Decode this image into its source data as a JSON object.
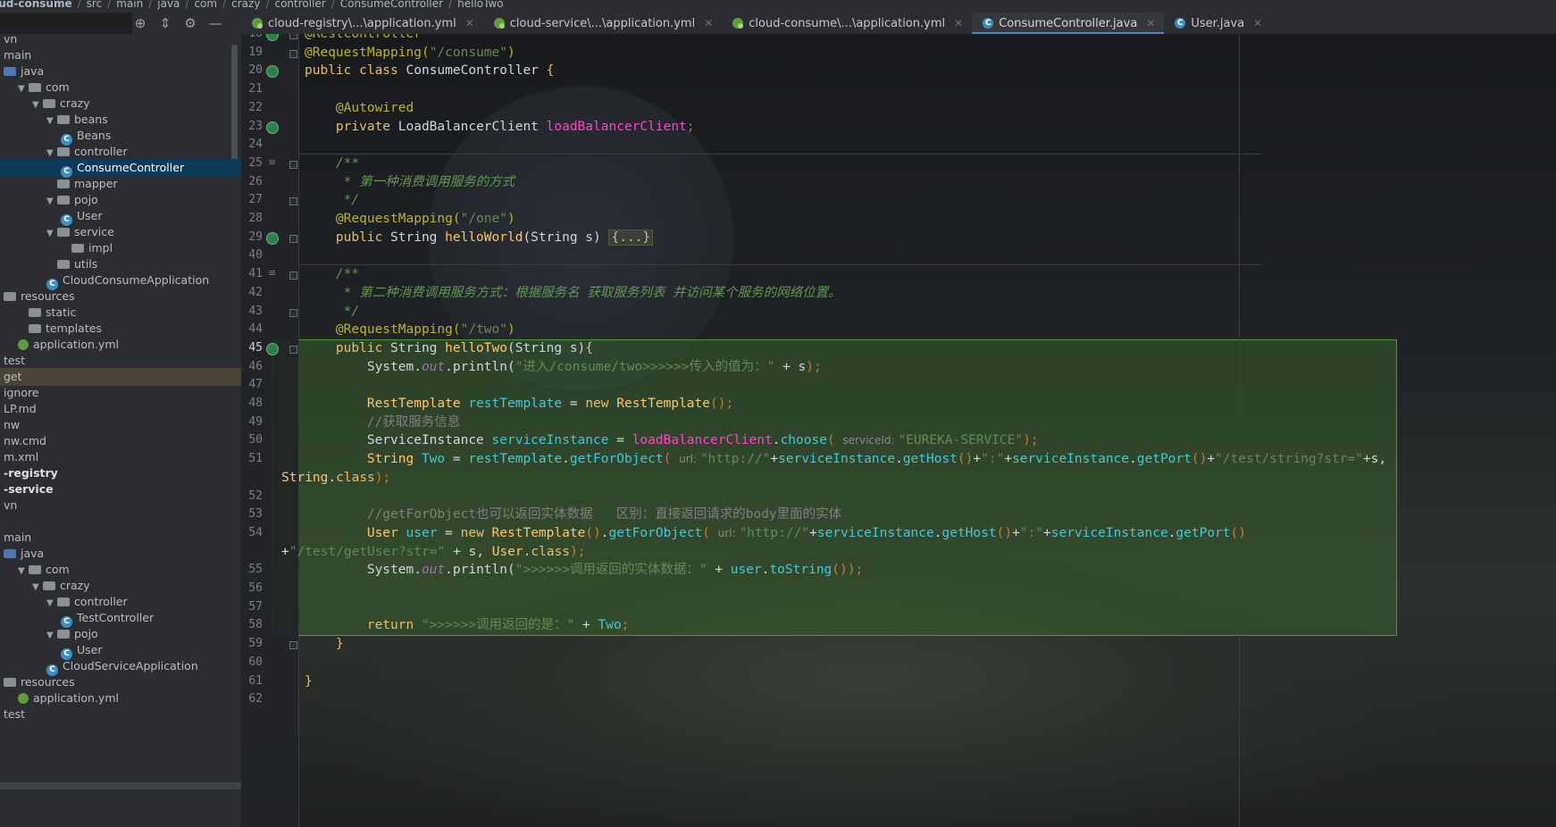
{
  "breadcrumb": [
    "oud-consume",
    "src",
    "main",
    "java",
    "com",
    "crazy",
    "controller",
    "ConsumeController",
    "helloTwo"
  ],
  "toolbar": {
    "icons": [
      "crosshair-icon",
      "collapse-icon",
      "gear-icon",
      "minimize-icon"
    ],
    "glyphs": [
      "⊕",
      "⇕",
      "⚙",
      "—"
    ]
  },
  "tabs": [
    {
      "label": "cloud-registry\\...\\application.yml",
      "icon": "yml",
      "active": false
    },
    {
      "label": "cloud-service\\...\\application.yml",
      "icon": "yml",
      "active": false
    },
    {
      "label": "cloud-consume\\...\\application.yml",
      "icon": "yml",
      "active": false
    },
    {
      "label": "ConsumeController.java",
      "icon": "class",
      "active": true
    },
    {
      "label": "User.java",
      "icon": "class",
      "active": false
    }
  ],
  "tab_close": "✕",
  "tree": [
    {
      "label": "vn",
      "indent": 0,
      "arrow": "",
      "icon": "none"
    },
    {
      "label": "main",
      "indent": 0,
      "arrow": "",
      "icon": "none"
    },
    {
      "label": "java",
      "indent": 0,
      "arrow": "",
      "icon": "folder-blue"
    },
    {
      "label": "com",
      "indent": 1,
      "arrow": "▼",
      "icon": "folder"
    },
    {
      "label": "crazy",
      "indent": 2,
      "arrow": "▼",
      "icon": "folder"
    },
    {
      "label": "beans",
      "indent": 3,
      "arrow": "▼",
      "icon": "folder"
    },
    {
      "label": "Beans",
      "indent": 4,
      "arrow": "",
      "icon": "class"
    },
    {
      "label": "controller",
      "indent": 3,
      "arrow": "▼",
      "icon": "folder"
    },
    {
      "label": "ConsumeController",
      "indent": 4,
      "arrow": "",
      "icon": "class",
      "selected": true
    },
    {
      "label": "mapper",
      "indent": 3,
      "arrow": "",
      "icon": "folder"
    },
    {
      "label": "pojo",
      "indent": 3,
      "arrow": "▼",
      "icon": "folder"
    },
    {
      "label": "User",
      "indent": 4,
      "arrow": "",
      "icon": "class"
    },
    {
      "label": "service",
      "indent": 3,
      "arrow": "▼",
      "icon": "folder"
    },
    {
      "label": "impl",
      "indent": 4,
      "arrow": "",
      "icon": "folder"
    },
    {
      "label": "utils",
      "indent": 3,
      "arrow": "",
      "icon": "folder"
    },
    {
      "label": "CloudConsumeApplication",
      "indent": 3,
      "arrow": "",
      "icon": "class"
    },
    {
      "label": "resources",
      "indent": 0,
      "arrow": "",
      "icon": "folder"
    },
    {
      "label": "static",
      "indent": 1,
      "arrow": "",
      "icon": "folder"
    },
    {
      "label": "templates",
      "indent": 1,
      "arrow": "",
      "icon": "folder"
    },
    {
      "label": "application.yml",
      "indent": 1,
      "arrow": "",
      "icon": "yml"
    },
    {
      "label": "test",
      "indent": 0,
      "arrow": "",
      "icon": "none"
    },
    {
      "label": "get",
      "indent": 0,
      "arrow": "",
      "icon": "none",
      "highlight": true
    },
    {
      "label": "ignore",
      "indent": 0,
      "arrow": "",
      "icon": "none"
    },
    {
      "label": "LP.md",
      "indent": 0,
      "arrow": "",
      "icon": "none"
    },
    {
      "label": "nw",
      "indent": 0,
      "arrow": "",
      "icon": "none"
    },
    {
      "label": "nw.cmd",
      "indent": 0,
      "arrow": "",
      "icon": "none"
    },
    {
      "label": "m.xml",
      "indent": 0,
      "arrow": "",
      "icon": "none"
    },
    {
      "label": "-registry",
      "indent": 0,
      "arrow": "",
      "icon": "none",
      "bold": true
    },
    {
      "label": "-service",
      "indent": 0,
      "arrow": "",
      "icon": "none",
      "bold": true
    },
    {
      "label": "vn",
      "indent": 0,
      "arrow": "",
      "icon": "none"
    },
    {
      "label": "",
      "indent": 0,
      "arrow": "",
      "icon": "none"
    },
    {
      "label": "main",
      "indent": 0,
      "arrow": "",
      "icon": "none"
    },
    {
      "label": "java",
      "indent": 0,
      "arrow": "",
      "icon": "folder-blue"
    },
    {
      "label": "com",
      "indent": 1,
      "arrow": "▼",
      "icon": "folder"
    },
    {
      "label": "crazy",
      "indent": 2,
      "arrow": "▼",
      "icon": "folder"
    },
    {
      "label": "controller",
      "indent": 3,
      "arrow": "▼",
      "icon": "folder"
    },
    {
      "label": "TestController",
      "indent": 4,
      "arrow": "",
      "icon": "class"
    },
    {
      "label": "pojo",
      "indent": 3,
      "arrow": "▼",
      "icon": "folder"
    },
    {
      "label": "User",
      "indent": 4,
      "arrow": "",
      "icon": "class"
    },
    {
      "label": "CloudServiceApplication",
      "indent": 3,
      "arrow": "",
      "icon": "class"
    },
    {
      "label": "resources",
      "indent": 0,
      "arrow": "",
      "icon": "folder"
    },
    {
      "label": "application.yml",
      "indent": 1,
      "arrow": "",
      "icon": "yml"
    },
    {
      "label": "test",
      "indent": 0,
      "arrow": "",
      "icon": "none"
    }
  ],
  "editor": {
    "current_line": "45",
    "lines": [
      {
        "n": "18",
        "g": "bean",
        "f": "fold",
        "segs": [
          [
            "ann",
            "@RestController"
          ]
        ]
      },
      {
        "n": "19",
        "g": "",
        "f": "fold",
        "segs": [
          [
            "ann",
            "@RequestMapping("
          ],
          [
            "str",
            "\"/consume\""
          ],
          [
            "ann",
            ")"
          ]
        ]
      },
      {
        "n": "20",
        "g": "bean",
        "f": "",
        "segs": [
          [
            "kwy",
            "public class "
          ],
          [
            "dim",
            "ConsumeController "
          ],
          [
            "kwy",
            "{"
          ]
        ]
      },
      {
        "n": "21",
        "g": "",
        "f": "",
        "segs": []
      },
      {
        "n": "22",
        "g": "",
        "f": "",
        "segs": [
          [
            "",
            "    "
          ],
          [
            "ann",
            "@Autowired"
          ]
        ]
      },
      {
        "n": "23",
        "g": "bean",
        "f": "",
        "segs": [
          [
            "",
            "    "
          ],
          [
            "kwy",
            "private "
          ],
          [
            "dim",
            "LoadBalancerClient "
          ],
          [
            "pink",
            "loadBalancerClient"
          ],
          [
            "kw",
            ";"
          ]
        ]
      },
      {
        "n": "24",
        "g": "",
        "f": "",
        "segs": []
      },
      {
        "n": "25",
        "g": "doc",
        "f": "fold",
        "segs": [
          [
            "",
            "    "
          ],
          [
            "doc",
            "/**"
          ]
        ]
      },
      {
        "n": "26",
        "g": "",
        "f": "",
        "segs": [
          [
            "",
            "    "
          ],
          [
            "doc",
            " * 第一种消费调用服务的方式"
          ]
        ]
      },
      {
        "n": "27",
        "g": "",
        "f": "fold",
        "segs": [
          [
            "",
            "    "
          ],
          [
            "doc",
            " */"
          ]
        ]
      },
      {
        "n": "28",
        "g": "",
        "f": "",
        "segs": [
          [
            "",
            "    "
          ],
          [
            "ann",
            "@RequestMapping("
          ],
          [
            "str",
            "\"/one\""
          ],
          [
            "ann",
            ")"
          ]
        ]
      },
      {
        "n": "29",
        "g": "bean",
        "f": "plus",
        "segs": [
          [
            "",
            "    "
          ],
          [
            "kwy",
            "public "
          ],
          [
            "dim",
            "String "
          ],
          [
            "yel",
            "helloWorld"
          ],
          [
            "dim",
            "(String s) "
          ],
          [
            "box",
            "{...}"
          ]
        ]
      },
      {
        "n": "40",
        "g": "",
        "f": "",
        "segs": []
      },
      {
        "n": "41",
        "g": "doc",
        "f": "fold",
        "segs": [
          [
            "",
            "    "
          ],
          [
            "doc",
            "/**"
          ]
        ]
      },
      {
        "n": "42",
        "g": "",
        "f": "",
        "segs": [
          [
            "",
            "    "
          ],
          [
            "doc",
            " * 第二种消费调用服务方式：根据服务名 获取服务列表 并访问某个服务的网络位置。"
          ]
        ]
      },
      {
        "n": "43",
        "g": "",
        "f": "fold",
        "segs": [
          [
            "",
            "    "
          ],
          [
            "doc",
            " */"
          ]
        ]
      },
      {
        "n": "44",
        "g": "",
        "f": "",
        "segs": [
          [
            "",
            "    "
          ],
          [
            "ann",
            "@RequestMapping("
          ],
          [
            "str",
            "\"/two\""
          ],
          [
            "ann",
            ")"
          ]
        ]
      },
      {
        "n": "45",
        "g": "bean",
        "f": "fold",
        "segs": [
          [
            "",
            "    "
          ],
          [
            "kwy",
            "public "
          ],
          [
            "dim",
            "String "
          ],
          [
            "yel",
            "helloTwo"
          ],
          [
            "dim",
            "(String s)"
          ],
          [
            "kwy",
            "{"
          ]
        ]
      },
      {
        "n": "46",
        "g": "",
        "f": "",
        "segs": [
          [
            "",
            "        "
          ],
          [
            "dim",
            "System."
          ],
          [
            "it",
            "out"
          ],
          [
            "dim",
            ".println("
          ],
          [
            "str",
            "\"进入/consume/two>>>>>>传入的值为：\" "
          ],
          [
            "dim",
            "+ s"
          ],
          [
            "kw",
            ");"
          ]
        ]
      },
      {
        "n": "47",
        "g": "",
        "f": "",
        "segs": []
      },
      {
        "n": "48",
        "g": "",
        "f": "",
        "segs": [
          [
            "",
            "        "
          ],
          [
            "yel",
            "RestTemplate "
          ],
          [
            "cyan",
            "restTemplate "
          ],
          [
            "dim",
            "= "
          ],
          [
            "kwy",
            "new "
          ],
          [
            "yel",
            "RestTemplate"
          ],
          [
            "kw",
            "();"
          ]
        ]
      },
      {
        "n": "49",
        "g": "",
        "f": "",
        "segs": [
          [
            "",
            "        "
          ],
          [
            "cmt",
            "//获取服务信息"
          ]
        ]
      },
      {
        "n": "50",
        "g": "",
        "f": "",
        "segs": [
          [
            "",
            "        "
          ],
          [
            "dim",
            "ServiceInstance "
          ],
          [
            "cyan",
            "serviceInstance "
          ],
          [
            "dim",
            "= "
          ],
          [
            "pink",
            "loadBalancerClient"
          ],
          [
            "dim",
            "."
          ],
          [
            "cyan",
            "choose"
          ],
          [
            "kw",
            "( "
          ],
          [
            "hint",
            "serviceId: "
          ],
          [
            "str",
            "\"EUREKA-SERVICE\""
          ],
          [
            "kw",
            ");"
          ]
        ]
      },
      {
        "n": "51",
        "g": "",
        "f": "",
        "segs": [
          [
            "",
            "        "
          ],
          [
            "yel",
            "String "
          ],
          [
            "cyan",
            "Two "
          ],
          [
            "dim",
            "= "
          ],
          [
            "cyan",
            "restTemplate"
          ],
          [
            "dim",
            "."
          ],
          [
            "cyan",
            "getForObject"
          ],
          [
            "kw",
            "( "
          ],
          [
            "hint",
            "url: "
          ],
          [
            "str",
            "\"http://\""
          ],
          [
            "dim",
            "+"
          ],
          [
            "cyan",
            "serviceInstance"
          ],
          [
            "dim",
            "."
          ],
          [
            "cyan",
            "getHost"
          ],
          [
            "kw",
            "()"
          ],
          [
            "dim",
            "+"
          ],
          [
            "str",
            "\":\""
          ],
          [
            "dim",
            "+"
          ],
          [
            "cyan",
            "serviceInstance"
          ],
          [
            "dim",
            "."
          ],
          [
            "cyan",
            "getPort"
          ],
          [
            "kw",
            "()"
          ],
          [
            "dim",
            "+"
          ],
          [
            "str",
            "\"/test/string?str=\""
          ],
          [
            "dim",
            "+s,"
          ]
        ]
      },
      {
        "n": "",
        "g": "",
        "f": "",
        "segs": [
          [
            "yel",
            "String"
          ],
          [
            "dim",
            "."
          ],
          [
            "kwy",
            "class"
          ],
          [
            "kw",
            ");"
          ]
        ]
      },
      {
        "n": "52",
        "g": "",
        "f": "",
        "segs": []
      },
      {
        "n": "53",
        "g": "",
        "f": "",
        "segs": [
          [
            "",
            "        "
          ],
          [
            "cmt",
            "//getForObject也可以返回实体数据   区别：直接返回请求的body里面的实体"
          ]
        ]
      },
      {
        "n": "54",
        "g": "",
        "f": "",
        "segs": [
          [
            "",
            "        "
          ],
          [
            "yel",
            "User "
          ],
          [
            "cyan",
            "user "
          ],
          [
            "dim",
            "= "
          ],
          [
            "kwy",
            "new "
          ],
          [
            "yel",
            "RestTemplate"
          ],
          [
            "kw",
            "()"
          ],
          [
            "dim",
            "."
          ],
          [
            "cyan",
            "getForObject"
          ],
          [
            "kw",
            "( "
          ],
          [
            "hint",
            "url: "
          ],
          [
            "str",
            "\"http://\""
          ],
          [
            "dim",
            "+"
          ],
          [
            "cyan",
            "serviceInstance"
          ],
          [
            "dim",
            "."
          ],
          [
            "cyan",
            "getHost"
          ],
          [
            "kw",
            "()"
          ],
          [
            "dim",
            "+"
          ],
          [
            "str",
            "\":\""
          ],
          [
            "dim",
            "+"
          ],
          [
            "cyan",
            "serviceInstance"
          ],
          [
            "dim",
            "."
          ],
          [
            "cyan",
            "getPort"
          ],
          [
            "kw",
            "()"
          ]
        ]
      },
      {
        "n": "",
        "g": "",
        "f": "",
        "segs": [
          [
            "dim",
            "+"
          ],
          [
            "str",
            "\"/test/getUser?str=\" "
          ],
          [
            "dim",
            "+ s, "
          ],
          [
            "yel",
            "User"
          ],
          [
            "dim",
            "."
          ],
          [
            "kwy",
            "class"
          ],
          [
            "kw",
            ");"
          ]
        ]
      },
      {
        "n": "55",
        "g": "",
        "f": "",
        "segs": [
          [
            "",
            "        "
          ],
          [
            "dim",
            "System."
          ],
          [
            "it",
            "out"
          ],
          [
            "dim",
            ".println("
          ],
          [
            "str",
            "\">>>>>>调用返回的实体数据：\" "
          ],
          [
            "dim",
            "+ "
          ],
          [
            "cyan",
            "user"
          ],
          [
            "dim",
            "."
          ],
          [
            "cyan",
            "toString"
          ],
          [
            "kw",
            "());"
          ]
        ]
      },
      {
        "n": "56",
        "g": "",
        "f": "",
        "segs": []
      },
      {
        "n": "57",
        "g": "",
        "f": "",
        "segs": []
      },
      {
        "n": "58",
        "g": "",
        "f": "",
        "segs": [
          [
            "",
            "        "
          ],
          [
            "kwy",
            "return "
          ],
          [
            "str",
            "\">>>>>>调用返回的是：\" "
          ],
          [
            "dim",
            "+ "
          ],
          [
            "cyan",
            "Two"
          ],
          [
            "kw",
            ";"
          ]
        ]
      },
      {
        "n": "59",
        "g": "",
        "f": "fold",
        "segs": [
          [
            "",
            "    "
          ],
          [
            "kwy",
            "}"
          ]
        ]
      },
      {
        "n": "60",
        "g": "",
        "f": "",
        "segs": []
      },
      {
        "n": "61",
        "g": "",
        "f": "",
        "segs": [
          [
            "kwy",
            "}"
          ]
        ]
      },
      {
        "n": "62",
        "g": "",
        "f": "",
        "segs": []
      }
    ]
  }
}
